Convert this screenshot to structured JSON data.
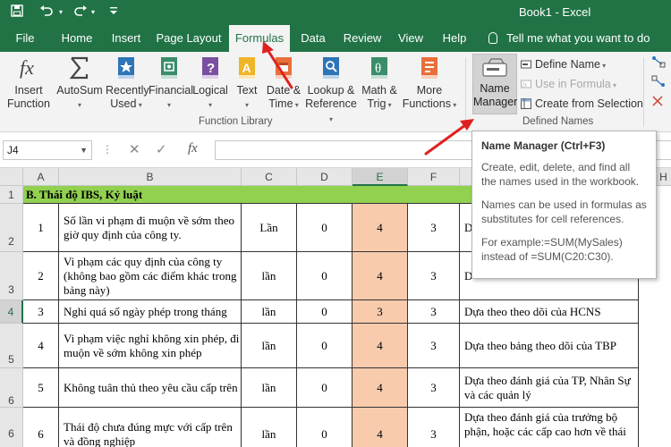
{
  "titlebar": {
    "title": "Book1  -  Excel"
  },
  "tabs": [
    {
      "label": "File"
    },
    {
      "label": "Home"
    },
    {
      "label": "Insert"
    },
    {
      "label": "Page Layout"
    },
    {
      "label": "Formulas"
    },
    {
      "label": "Data"
    },
    {
      "label": "Review"
    },
    {
      "label": "View"
    },
    {
      "label": "Help"
    }
  ],
  "tell_me": "Tell me what you want to do",
  "ribbon": {
    "insert_function": "Insert\nFunction",
    "autosum": "AutoSum",
    "recently_used": "Recently\nUsed",
    "financial": "Financial",
    "logical": "Logical",
    "text": "Text",
    "date_time": "Date &\nTime",
    "lookup_reference": "Lookup &\nReference",
    "math_trig": "Math &\nTrig",
    "more_functions": "More\nFunctions",
    "function_library_label": "Function Library",
    "name_manager": "Name\nManager",
    "define_name": "Define Name",
    "use_in_formula": "Use in Formula",
    "create_from_selection": "Create from Selection",
    "defined_names_label": "Defined Names"
  },
  "formula_bar": {
    "name_box": "J4",
    "fx": "fx"
  },
  "columns": [
    "A",
    "B",
    "C",
    "D",
    "E",
    "F",
    "H"
  ],
  "rows": [
    {
      "num": "1",
      "header": "B. Thái độ IBS, Kỷ luật"
    },
    {
      "num": "2",
      "a": "1",
      "b": "Số lần vi phạm đi muộn về sớm theo giờ quy định của công ty.",
      "c": "Lần",
      "d": "0",
      "e": "4",
      "f": "3",
      "g": "D"
    },
    {
      "num": "3",
      "a": "2",
      "b": "Vi phạm các quy định của công ty (không bao gồm các điểm khác trong bảng này)",
      "c": "lần",
      "d": "0",
      "e": "4",
      "f": "3",
      "g": "D"
    },
    {
      "num": "4",
      "a": "3",
      "b": "Nghỉ quá số ngày phép trong tháng",
      "c": "lần",
      "d": "0",
      "e": "3",
      "f": "3",
      "g": "Dựa theo theo dõi của HCNS"
    },
    {
      "num": "5",
      "a": "4",
      "b": "Vi phạm việc nghỉ không xin phép, đi muộn về sớm không xin phép",
      "c": "lần",
      "d": "0",
      "e": "4",
      "f": "3",
      "g": "Dựa theo bảng theo dõi của TBP"
    },
    {
      "num": "6",
      "a": "5",
      "b": "Không tuân thủ theo yêu cầu cấp trên",
      "c": "lần",
      "d": "0",
      "e": "4",
      "f": "3",
      "g": "Dựa theo đánh giá của TP, Nhân Sự và các quản lý"
    },
    {
      "num": "6",
      "a": "6",
      "b": "Thái độ chưa đúng mực với cấp trên và đồng nghiệp",
      "c": "lần",
      "d": "0",
      "e": "4",
      "f": "3",
      "g": "Dựa theo đánh giá của trưởng bộ phận, hoặc các cấp cao hơn về thái"
    }
  ],
  "tooltip": {
    "title": "Name Manager (Ctrl+F3)",
    "p1": "Create, edit, delete, and find all the names used in the workbook.",
    "p2": "Names can be used in formulas as substitutes for cell references.",
    "p3": "For example:=SUM(MySales) instead of =SUM(C20:C30)."
  },
  "colors": {
    "excel_green": "#217346",
    "header_fill": "#92d050",
    "orange_fill": "#f8cbad",
    "arrow_red": "#e02020"
  }
}
